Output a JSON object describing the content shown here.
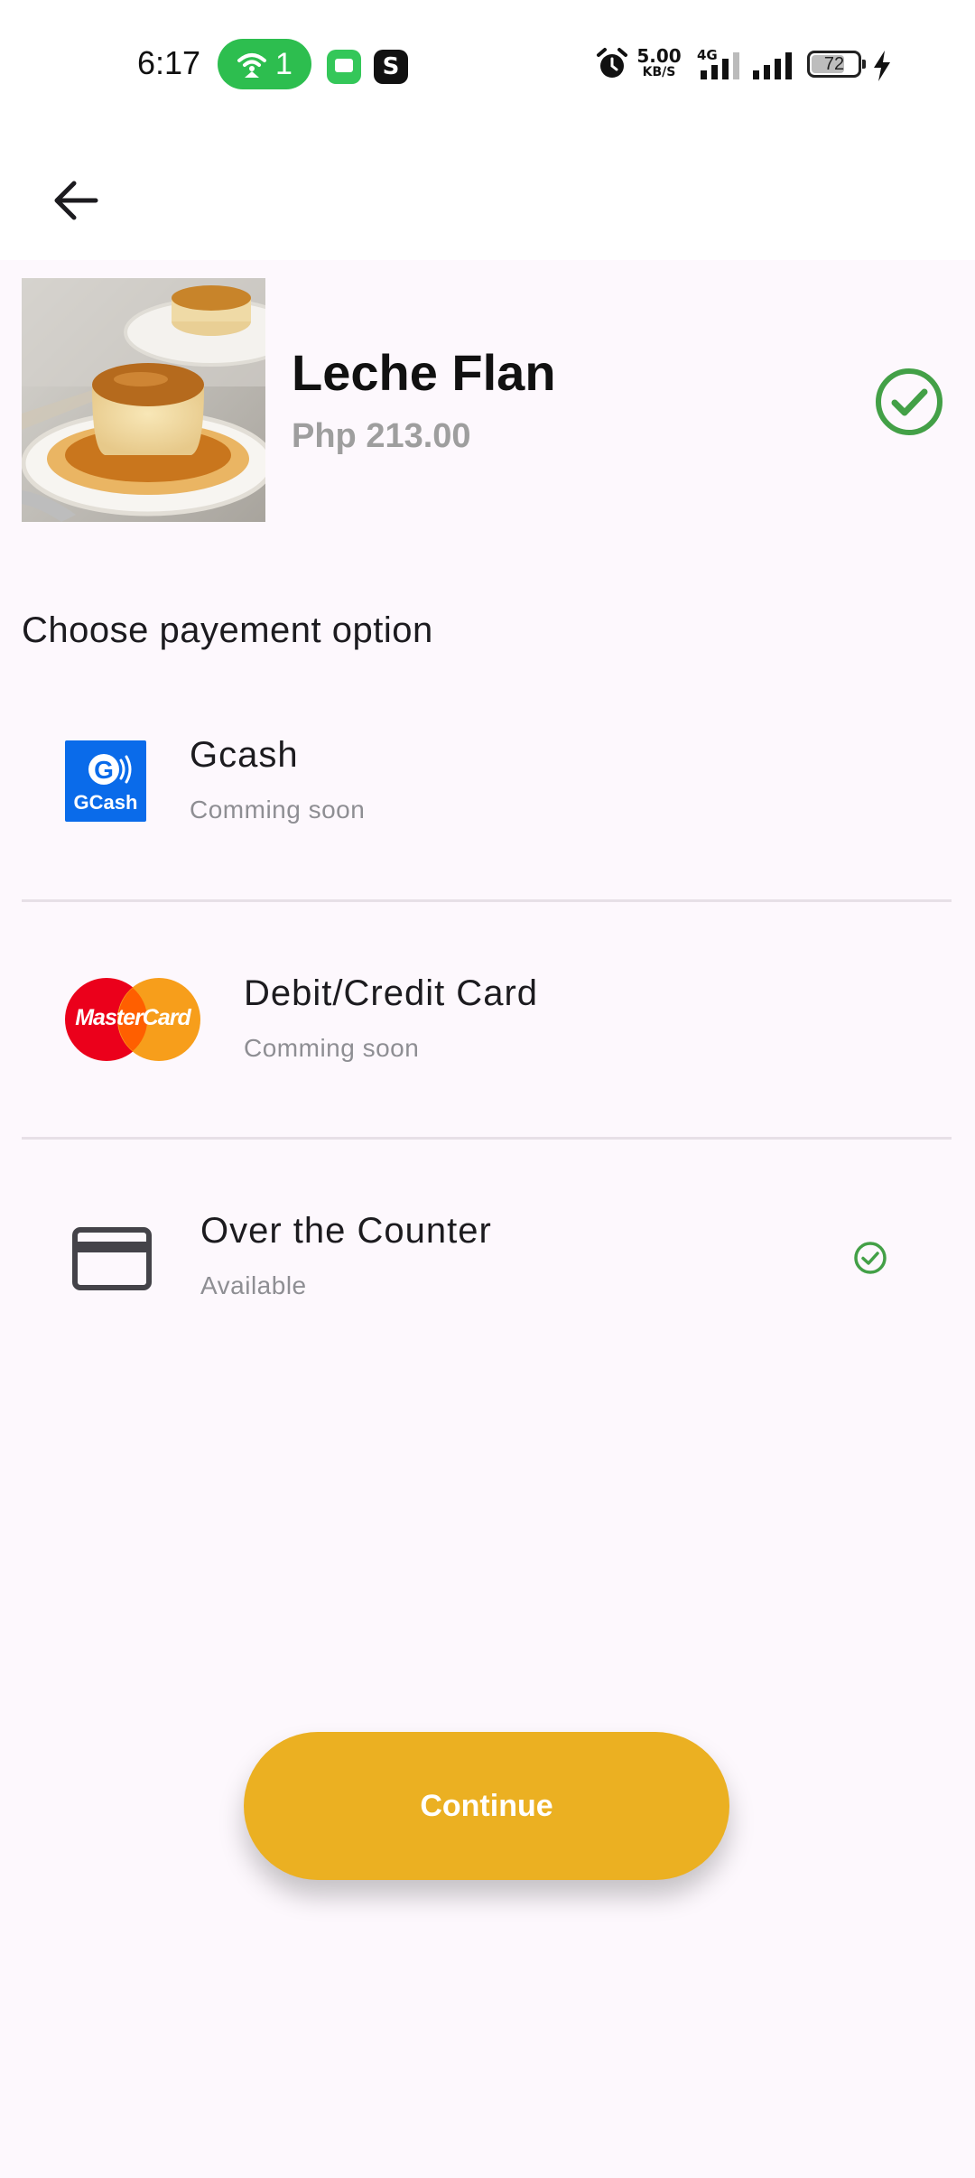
{
  "status_bar": {
    "time": "6:17",
    "hotspot_count": "1",
    "net_speed": "5.00",
    "net_speed_unit": "KB/S",
    "network_type": "4G",
    "battery_level": "72",
    "battery_fraction": 0.72
  },
  "app_bar": {
    "back_icon": "arrow-back-icon"
  },
  "product": {
    "name": "Leche Flan",
    "price": "Php 213.00",
    "selected_icon": "check-circle-icon",
    "image_icon": "leche-flan-photo"
  },
  "payment": {
    "section_title": "Choose payement option",
    "options": [
      {
        "title": "Gcash",
        "status": "Comming soon",
        "logo_text": "GCash",
        "icon": "gcash-logo"
      },
      {
        "title": "Debit/Credit Card",
        "status": "Comming soon",
        "logo_text": "MasterCard",
        "icon": "mastercard-logo"
      },
      {
        "title": "Over the Counter",
        "status": "Available",
        "icon": "credit-card-icon",
        "selected_icon": "check-circle-icon"
      }
    ]
  },
  "actions": {
    "continue_label": "Continue"
  },
  "colors": {
    "background": "#fdf8fd",
    "accent": "#ebb022",
    "success": "#43a047",
    "gcash_blue": "#0a6bea",
    "mastercard_red": "#eb001b",
    "mastercard_orange": "#f79e1b",
    "subtext": "#8e8e93"
  }
}
